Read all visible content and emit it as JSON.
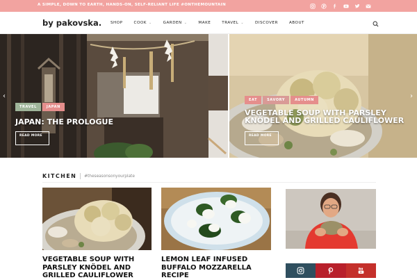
{
  "topbar": {
    "tagline": "A SIMPLE, DOWN TO EARTH, HANDS-ON, SELF-RELIANT LIFE #ONTHEMOUNTAIN",
    "social_icons": [
      "instagram-icon",
      "pinterest-icon",
      "facebook-icon",
      "youtube-icon",
      "twitter-icon",
      "email-icon"
    ],
    "bg_color": "#f2a3a0"
  },
  "header": {
    "logo": "by pakovska.",
    "nav": [
      {
        "label": "SHOP",
        "dropdown": false
      },
      {
        "label": "COOK",
        "dropdown": true
      },
      {
        "label": "GARDEN",
        "dropdown": true
      },
      {
        "label": "MAKE",
        "dropdown": false
      },
      {
        "label": "TRAVEL",
        "dropdown": true
      },
      {
        "label": "DISCOVER",
        "dropdown": false
      },
      {
        "label": "ABOUT",
        "dropdown": false
      }
    ]
  },
  "slider": {
    "slides": [
      {
        "categories": [
          {
            "label": "TRAVEL",
            "color": "#9fb59a"
          },
          {
            "label": "JAPAN",
            "color": "#e58e8c"
          }
        ],
        "title": "JAPAN: THE PROLOGUE",
        "read_more": "READ MORE"
      },
      {
        "categories": [
          {
            "label": "EAT",
            "color": "#e58e8c"
          },
          {
            "label": "SAVORY",
            "color": "#d99a96"
          },
          {
            "label": "AUTUMN",
            "color": "#e58e8c"
          }
        ],
        "title": "VEGETABLE SOUP WITH PARSLEY KNÖDEL AND GRILLED CAULIFLOWER",
        "read_more": "READ MORE"
      }
    ]
  },
  "kitchen": {
    "title": "KITCHEN",
    "tag": "#theseasonsonyourplate",
    "posts": [
      {
        "title": "VEGETABLE SOUP WITH PARSLEY KNÖDEL AND GRILLED CAULIFLOWER"
      },
      {
        "title": "LEMON LEAF INFUSED BUFFALO MOZZARELLA RECIPE"
      }
    ]
  },
  "sidebar": {
    "social_tiles": [
      {
        "name": "instagram",
        "color": "#2f4f5f"
      },
      {
        "name": "pinterest",
        "color": "#b8202b"
      },
      {
        "name": "youtube",
        "color": "#c4302b"
      }
    ]
  }
}
